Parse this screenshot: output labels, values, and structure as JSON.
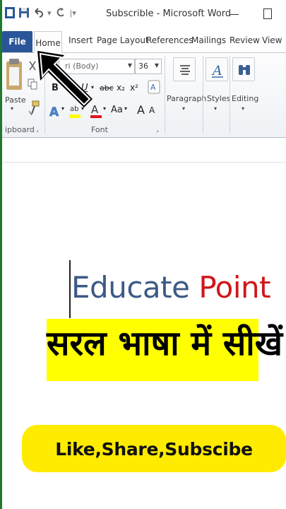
{
  "window": {
    "title": "Subscrible  -  Microsoft Word"
  },
  "quick_access": {
    "items": [
      "word-icon",
      "save-icon",
      "undo-icon",
      "redo-icon",
      "customize-icon"
    ],
    "undo_arrow": "▾"
  },
  "tabs": [
    {
      "label": "File"
    },
    {
      "label": "Home"
    },
    {
      "label": "Insert"
    },
    {
      "label": "Page Layout"
    },
    {
      "label": "References"
    },
    {
      "label": "Mailings"
    },
    {
      "label": "Review"
    },
    {
      "label": "View"
    }
  ],
  "ribbon": {
    "clipboard": {
      "paste_label": "Paste",
      "group_label": "ipboard"
    },
    "font": {
      "font_name": "ri (Body)",
      "font_size": "36",
      "group_label": "Font",
      "bold": "B",
      "italic": "I",
      "underline": "U",
      "strike": "abc",
      "subscript": "x₂",
      "superscript": "x²",
      "grow": "A",
      "shrink": "A"
    },
    "paragraph": {
      "label": "Paragraph"
    },
    "styles": {
      "label": "Styles"
    },
    "editing": {
      "label": "Editing"
    }
  },
  "document": {
    "line1_word1": "Educate",
    "line1_word2": "Point",
    "line2": "सरल भाषा में सीखें",
    "banner": "Like,Share,Subscibe"
  },
  "colors": {
    "file_tab": "#2a5699",
    "educate": "#3c5a86",
    "point": "#d0161b",
    "highlight": "#ffff00",
    "banner": "#ffeb00"
  }
}
